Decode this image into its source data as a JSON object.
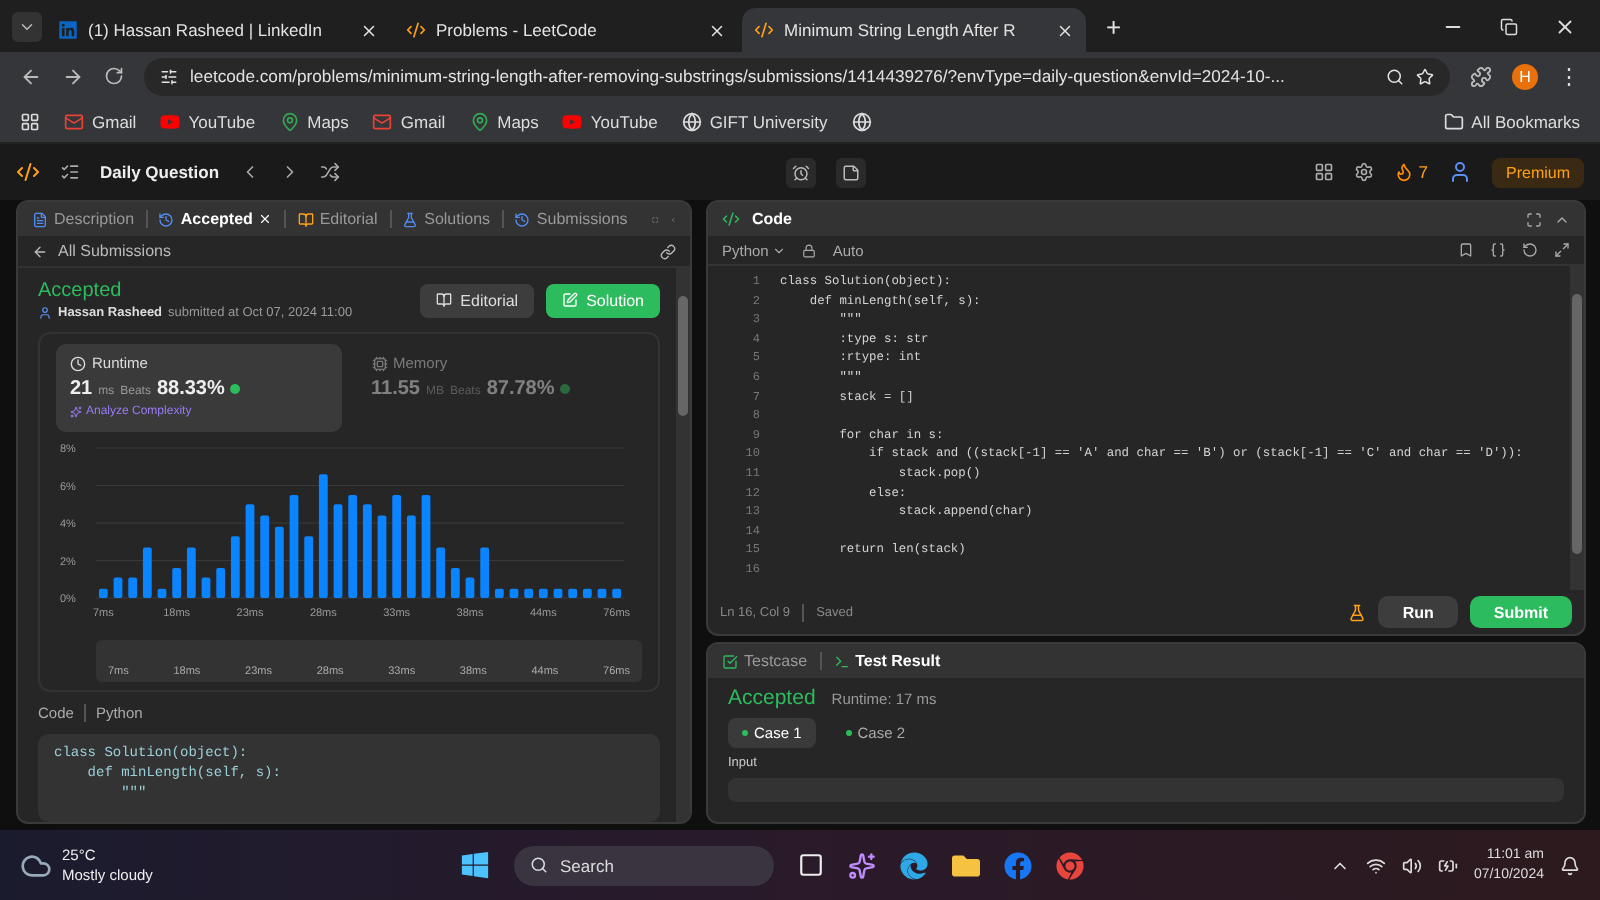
{
  "browser": {
    "tabs": [
      {
        "title": "(1) Hassan Rasheed | LinkedIn",
        "kind": "linkedin",
        "selected": false
      },
      {
        "title": "Problems - LeetCode",
        "kind": "leetcode",
        "selected": false
      },
      {
        "title": "Minimum String Length After R",
        "kind": "leetcode",
        "selected": true
      }
    ],
    "new_tab": "+",
    "menu": "⋮",
    "address": "leetcode.com/problems/minimum-string-length-after-removing-substrings/submissions/1414439276/?envType=daily-question&envId=2024-10-...",
    "profile": "H",
    "bookmarks": [
      {
        "label": "Gmail",
        "kind": "gmail"
      },
      {
        "label": "YouTube",
        "kind": "youtube"
      },
      {
        "label": "Maps",
        "kind": "maps"
      },
      {
        "label": "Gmail",
        "kind": "gmail"
      },
      {
        "label": "Maps",
        "kind": "maps"
      },
      {
        "label": "YouTube",
        "kind": "youtube"
      },
      {
        "label": "GIFT University",
        "kind": "globe"
      }
    ],
    "all_bookmarks": "All Bookmarks"
  },
  "nav": {
    "title": "Daily Question",
    "streak": "7",
    "premium": "Premium"
  },
  "left": {
    "tabs": [
      {
        "label": "Description",
        "selected": false
      },
      {
        "label": "Accepted",
        "selected": true
      },
      {
        "label": "Editorial",
        "selected": false
      },
      {
        "label": "Solutions",
        "selected": false
      },
      {
        "label": "Submissions",
        "selected": false
      }
    ],
    "back": "All Submissions",
    "status": "Accepted",
    "author": "Hassan Rasheed",
    "submitted": "submitted at Oct 07, 2024 11:00",
    "buttons": [
      {
        "label": "Editorial",
        "kind": "secondary"
      },
      {
        "label": "Solution",
        "kind": "primary"
      }
    ],
    "stats": [
      {
        "title": "Runtime",
        "kind": "runtime",
        "value": "21",
        "unit": "ms",
        "beats_label": "Beats",
        "beats": "88.33%",
        "selected": true,
        "link": "Analyze Complexity"
      },
      {
        "title": "Memory",
        "kind": "memory",
        "value": "11.55",
        "unit": "MB",
        "beats_label": "Beats",
        "beats": "87.78%",
        "selected": false
      }
    ],
    "chart_data": {
      "type": "bar",
      "grid": true,
      "categories": [
        "7ms",
        null,
        null,
        null,
        null,
        "18ms",
        null,
        null,
        null,
        null,
        "23ms",
        null,
        null,
        null,
        null,
        "28ms",
        null,
        null,
        null,
        null,
        "33ms",
        null,
        null,
        null,
        null,
        "38ms",
        null,
        null,
        null,
        null,
        "44ms",
        null,
        null,
        null,
        null,
        "76ms"
      ],
      "values": [
        0.5,
        1.1,
        1.1,
        2.7,
        0.5,
        1.6,
        2.7,
        1.1,
        1.6,
        3.3,
        5,
        4.4,
        3.8,
        5.5,
        3.3,
        6.6,
        5,
        5.5,
        5,
        4.4,
        5.5,
        4.4,
        5.5,
        2.7,
        1.6,
        1.1,
        2.7,
        0.5,
        0.5,
        0.5,
        0.5,
        0.5,
        0.5,
        0.5,
        0.5,
        0.5
      ],
      "ylim": [
        0,
        8
      ],
      "yticks": [
        {
          "value": 0,
          "label": "0%"
        },
        {
          "value": 2,
          "label": "2%"
        },
        {
          "value": 4,
          "label": "4%"
        },
        {
          "value": 6,
          "label": "6%"
        },
        {
          "value": 8,
          "label": "8%"
        }
      ]
    },
    "overview_labels": [
      "7ms",
      "18ms",
      "23ms",
      "28ms",
      "33ms",
      "38ms",
      "44ms",
      "76ms"
    ],
    "code_label": "Code",
    "language": "Python",
    "code": [
      "class Solution(object):",
      "    def minLength(self, s):",
      "        \"\"\""
    ]
  },
  "editor": {
    "title": "Code",
    "language": "Python",
    "mode": "Auto",
    "lines": [
      {
        "n": "1",
        "text": "class Solution(object):"
      },
      {
        "n": "2",
        "text": "    def minLength(self, s):"
      },
      {
        "n": "3",
        "text": "        \"\"\""
      },
      {
        "n": "4",
        "text": "        :type s: str"
      },
      {
        "n": "5",
        "text": "        :rtype: int"
      },
      {
        "n": "6",
        "text": "        \"\"\""
      },
      {
        "n": "7",
        "text": "        stack = []"
      },
      {
        "n": "8"
      },
      {
        "n": "9",
        "text": "        for char in s:"
      },
      {
        "n": "10",
        "text": "            if stack and ((stack[-1] == 'A' and char == 'B') or (stack[-1] == 'C' and char == 'D')):"
      },
      {
        "n": "11",
        "text": "                stack.pop()"
      },
      {
        "n": "12",
        "text": "            else:"
      },
      {
        "n": "13",
        "text": "                stack.append(char)"
      },
      {
        "n": "14"
      },
      {
        "n": "15",
        "text": "        return len(stack)"
      },
      {
        "n": "16"
      }
    ],
    "position": "Ln 16, Col 9",
    "saved": "Saved",
    "run": "Run",
    "submit": "Submit"
  },
  "console": {
    "tabs": [
      {
        "label": "Testcase",
        "selected": false
      },
      {
        "label": "Test Result",
        "selected": true
      }
    ],
    "status": "Accepted",
    "runtime": "Runtime: 17 ms",
    "cases": [
      {
        "label": "Case 1",
        "selected": true
      },
      {
        "label": "Case 2",
        "selected": false
      }
    ],
    "input_label": "Input"
  },
  "taskbar": {
    "temperature": "25°C",
    "weather": "Mostly cloudy",
    "search": "Search",
    "time": "11:01 am",
    "date": "07/10/2024"
  }
}
